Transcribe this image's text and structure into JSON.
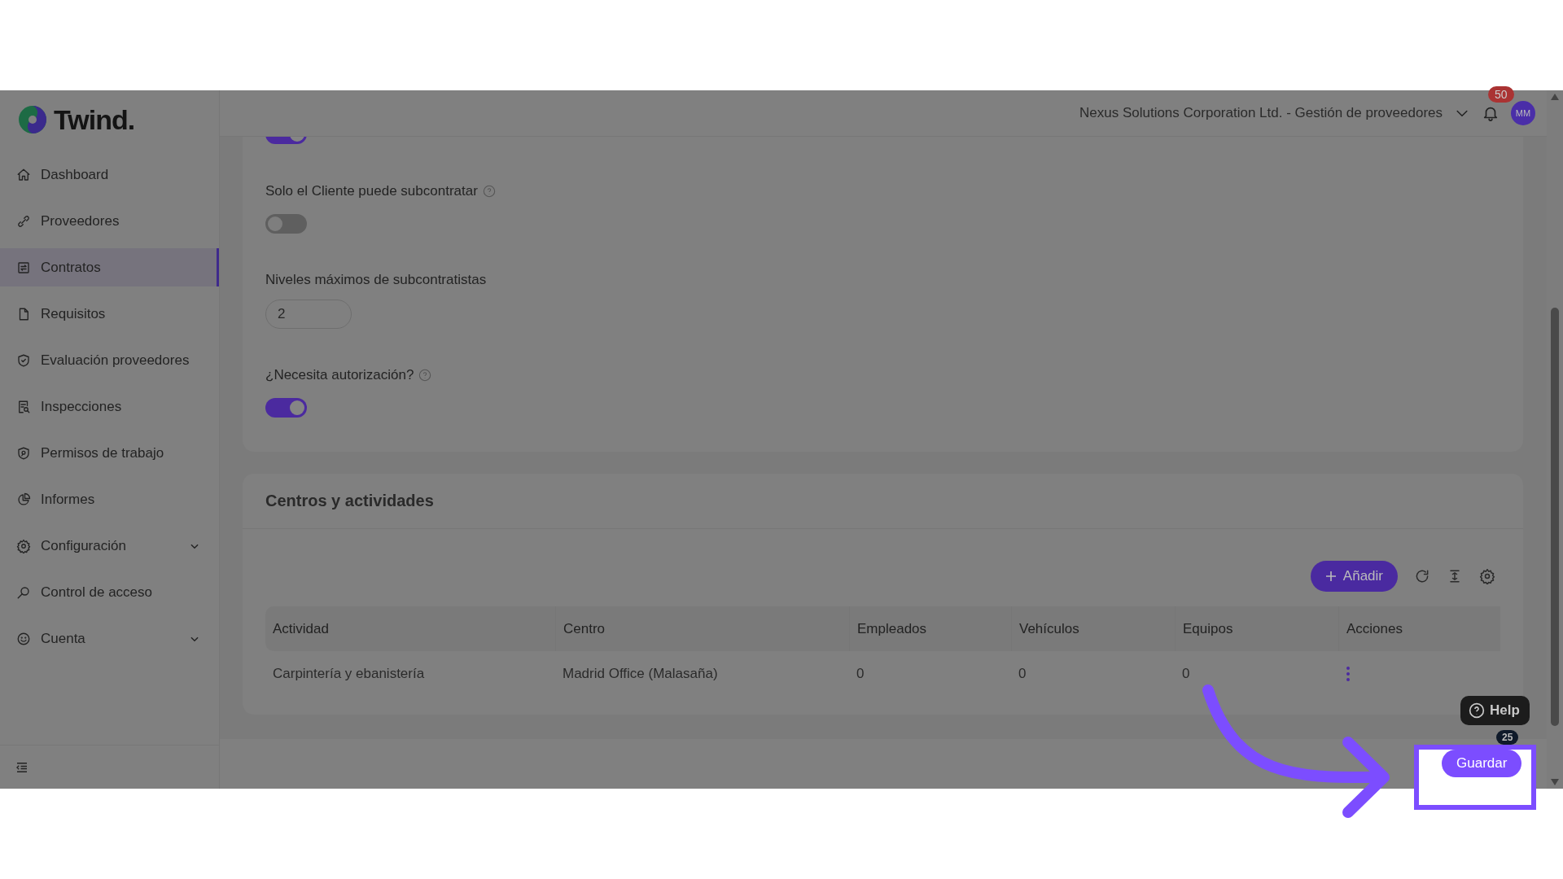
{
  "app": {
    "logo": "Twind.",
    "org_selector": "Nexus Solutions Corporation Ltd. - Gestión de proveedores",
    "notification_count": "50",
    "avatar": "MM"
  },
  "sidebar": {
    "items": [
      {
        "label": "Dashboard",
        "selected": false,
        "expandable": false
      },
      {
        "label": "Proveedores",
        "selected": false,
        "expandable": false
      },
      {
        "label": "Contratos",
        "selected": true,
        "expandable": false
      },
      {
        "label": "Requisitos",
        "selected": false,
        "expandable": false
      },
      {
        "label": "Evaluación proveedores",
        "selected": false,
        "expandable": false
      },
      {
        "label": "Inspecciones",
        "selected": false,
        "expandable": false
      },
      {
        "label": "Permisos de trabajo",
        "selected": false,
        "expandable": false
      },
      {
        "label": "Informes",
        "selected": false,
        "expandable": false
      },
      {
        "label": "Configuración",
        "selected": false,
        "expandable": true
      },
      {
        "label": "Control de acceso",
        "selected": false,
        "expandable": false
      },
      {
        "label": "Cuenta",
        "selected": false,
        "expandable": true
      }
    ]
  },
  "form": {
    "fields": [
      {
        "kind": "toggle",
        "on": true
      },
      {
        "kind": "toggle",
        "label": "Solo el Cliente puede subcontratar",
        "help": true,
        "on": false
      },
      {
        "kind": "number",
        "label": "Niveles máximos de subcontratistas",
        "value": "2"
      },
      {
        "kind": "toggle",
        "label": "¿Necesita autorización?",
        "help": true,
        "on": true
      }
    ]
  },
  "section": {
    "title": "Centros y actividades",
    "add_button": "Añadir",
    "table": {
      "columns": [
        "Actividad",
        "Centro",
        "Empleados",
        "Vehículos",
        "Equipos",
        "Acciones"
      ],
      "rows": [
        [
          "Carpintería y ebanistería",
          "Madrid Office (Malasaña)",
          "0",
          "0",
          "0"
        ]
      ]
    }
  },
  "help_widget": {
    "label": "Help",
    "count": "25"
  },
  "save_button": "Guardar"
}
